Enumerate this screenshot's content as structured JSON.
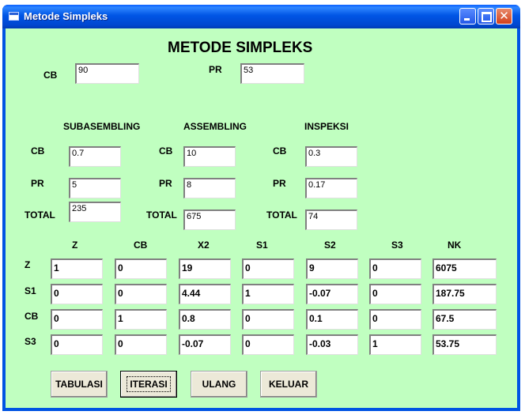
{
  "window": {
    "title": "Metode Simpleks"
  },
  "heading": "METODE SIMPLEKS",
  "top": {
    "cb_label": "CB",
    "cb_value": "90",
    "pr_label": "PR",
    "pr_value": "53"
  },
  "sections": {
    "subasembling": {
      "title": "SUBASEMBLING",
      "cb_label": "CB",
      "cb": "0.7",
      "pr_label": "PR",
      "pr": "5",
      "total_label": "TOTAL",
      "total": "235"
    },
    "assembling": {
      "title": "ASSEMBLING",
      "cb_label": "CB",
      "cb": "10",
      "pr_label": "PR",
      "pr": "8",
      "total_label": "TOTAL",
      "total": "675"
    },
    "inspeksi": {
      "title": "INSPEKSI",
      "cb_label": "CB",
      "cb": "0.3",
      "pr_label": "PR",
      "pr": "0.17",
      "total_label": "TOTAL",
      "total": "74"
    }
  },
  "table": {
    "headers": [
      "Z",
      "CB",
      "X2",
      "S1",
      "S2",
      "S3",
      "NK"
    ],
    "row_labels": [
      "Z",
      "S1",
      "CB",
      "S3"
    ],
    "rows": [
      [
        "1",
        "0",
        "19",
        "0",
        "9",
        "0",
        "6075"
      ],
      [
        "0",
        "0",
        "4.44",
        "1",
        "-0.07",
        "0",
        "187.75"
      ],
      [
        "0",
        "1",
        "0.8",
        "0",
        "0.1",
        "0",
        "67.5"
      ],
      [
        "0",
        "0",
        "-0.07",
        "0",
        "-0.03",
        "1",
        "53.75"
      ]
    ]
  },
  "buttons": {
    "tabulasi": "TABULASI",
    "iterasi": "ITERASI",
    "ulang": "ULANG",
    "keluar": "KELUAR"
  }
}
